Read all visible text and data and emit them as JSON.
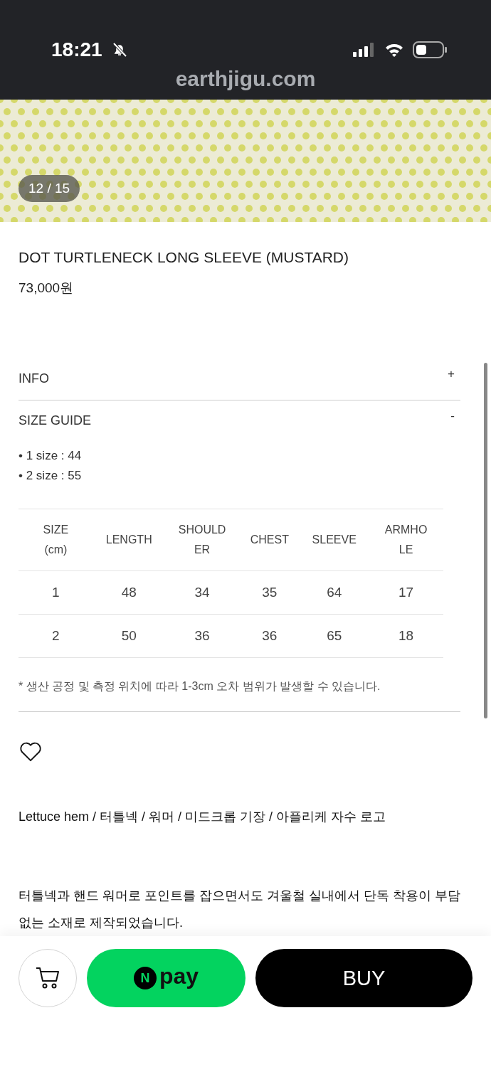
{
  "status_bar": {
    "time": "18:21",
    "silent": true
  },
  "browser": {
    "url": "earthjigu.com"
  },
  "gallery": {
    "kind": "picture",
    "counter": "12 / 15"
  },
  "product": {
    "title": "DOT TURTLENECK LONG SLEEVE (MUSTARD)",
    "price": "73,000원"
  },
  "sections": [
    {
      "label": "INFO",
      "toggle": "+",
      "expanded": false
    },
    {
      "label": "SIZE GUIDE",
      "toggle": "-",
      "expanded": true
    }
  ],
  "size_guide": {
    "bullets": [
      "• 1 size : 44",
      "• 2 size : 55"
    ],
    "table": {
      "columns": [
        "SIZE (cm)",
        "LENGTH",
        "SHOULDER",
        "CHEST",
        "SLEEVE",
        "ARMHOLE"
      ],
      "rows": [
        [
          "1",
          "48",
          "34",
          "35",
          "64",
          "17"
        ],
        [
          "2",
          "50",
          "36",
          "36",
          "65",
          "18"
        ]
      ]
    },
    "note": "* 생산 공정 및 측정 위치에 따라 1-3cm 오차 범위가 발생할 수 있습니다."
  },
  "liked": false,
  "description": [
    "Lettuce hem / 터틀넥 / 워머  / 미드크롭 기장 / 아플리케 자수 로고",
    "터틀넥과 핸드 워머로 포인트를 잡으면서도 겨울철 실내에서 단독 착용이 부담없는 소재로 제작되었습니다."
  ],
  "actions": {
    "npay": {
      "mark": "N",
      "label": "pay"
    },
    "buy": "BUY"
  }
}
